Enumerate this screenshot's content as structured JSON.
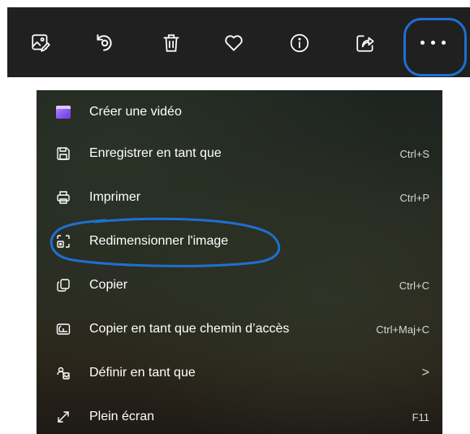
{
  "toolbar": {
    "buttons": [
      {
        "name": "edit-image",
        "icon": "edit-image-icon"
      },
      {
        "name": "rotate",
        "icon": "rotate-icon"
      },
      {
        "name": "delete",
        "icon": "trash-icon"
      },
      {
        "name": "favorite",
        "icon": "heart-icon"
      },
      {
        "name": "info",
        "icon": "info-icon"
      },
      {
        "name": "share",
        "icon": "share-icon"
      },
      {
        "name": "more",
        "icon": "more-icon"
      }
    ]
  },
  "menu": {
    "items": [
      {
        "label": "Créer une vidéo",
        "shortcut": "",
        "icon": "video-clapper-icon"
      },
      {
        "label": "Enregistrer en tant que",
        "shortcut": "Ctrl+S",
        "icon": "save-icon"
      },
      {
        "label": "Imprimer",
        "shortcut": "Ctrl+P",
        "icon": "print-icon"
      },
      {
        "label": "Redimensionner l'image",
        "shortcut": "",
        "icon": "resize-image-icon"
      },
      {
        "label": "Copier",
        "shortcut": "Ctrl+C",
        "icon": "copy-icon"
      },
      {
        "label": "Copier en tant que chemin d’accès",
        "shortcut": "Ctrl+Maj+C",
        "icon": "copy-path-icon"
      },
      {
        "label": "Définir en tant que",
        "shortcut": ">",
        "icon": "set-as-icon"
      },
      {
        "label": "Plein écran",
        "shortcut": "F11",
        "icon": "fullscreen-icon"
      }
    ]
  },
  "colors": {
    "toolbar_bg": "#202020",
    "annotation": "#1f6fd1",
    "text": "#ffffff"
  }
}
